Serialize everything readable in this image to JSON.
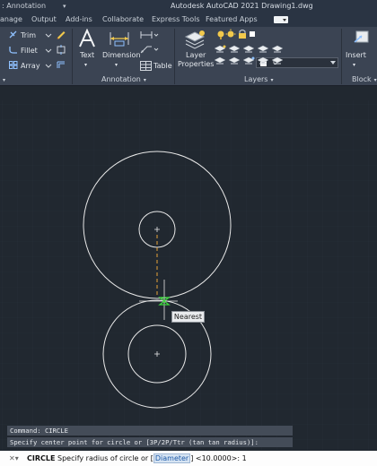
{
  "titlebar": {
    "workspace": ": Annotation",
    "title": "Autodesk AutoCAD 2021    Drawing1.dwg"
  },
  "tabs": [
    "anage",
    "Output",
    "Add-ins",
    "Collaborate",
    "Express Tools",
    "Featured Apps"
  ],
  "ribbon": {
    "modify": {
      "trim": "Trim",
      "fillet": "Fillet",
      "array": "Array"
    },
    "annotation": {
      "text": "Text",
      "dimension": "Dimension",
      "table": "Table",
      "label": "Annotation"
    },
    "layers": {
      "layer_properties_line1": "Layer",
      "layer_properties_line2": "Properties",
      "current_layer": "0",
      "label": "Layers"
    },
    "block": {
      "insert": "Insert",
      "label": "Block"
    }
  },
  "snap_tooltip": "Nearest",
  "command_history": [
    "Command:  CIRCLE",
    "Specify center point for circle or [3P/2P/Ttr (tan tan radius)]:"
  ],
  "command_line": {
    "command": "CIRCLE",
    "prompt_before": " Specify radius of circle or ",
    "option": "Diameter",
    "prompt_after": " <10.0000>: ",
    "input": "1"
  },
  "colors": {
    "canvas": "#212830",
    "ribbon": "#3b4453",
    "geometry": "#e8e8e8",
    "tracking_line": "#e8a33a",
    "snap_marker": "#3dd63d"
  }
}
